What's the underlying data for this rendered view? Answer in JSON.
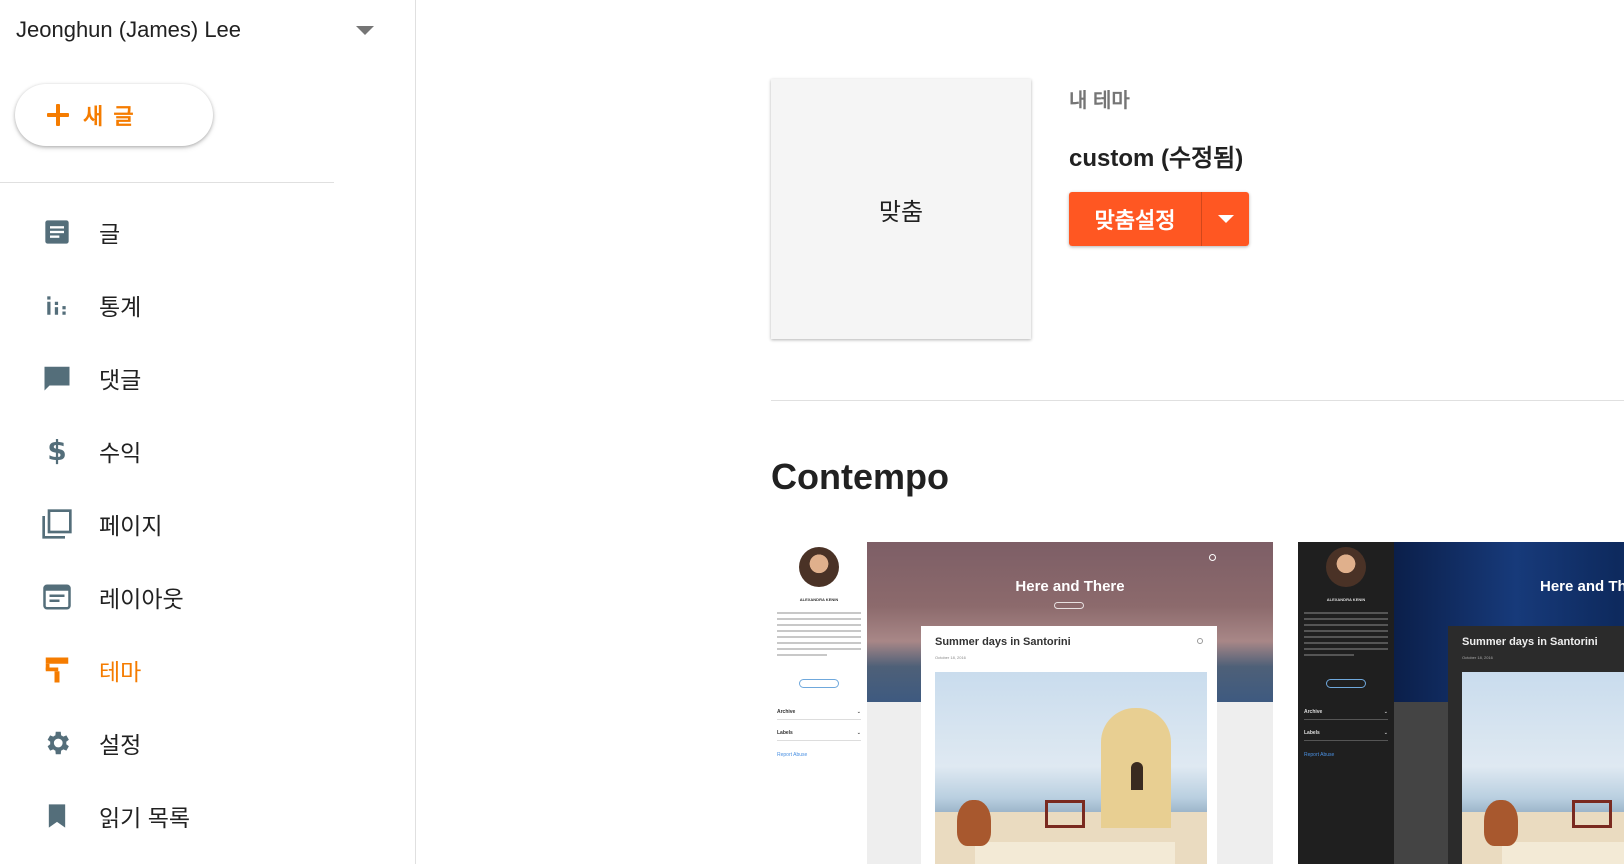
{
  "sidebar": {
    "account_name": "Jeonghun (James) Lee",
    "new_post_label": "새 글",
    "items": [
      {
        "label": "글",
        "icon": "posts-icon"
      },
      {
        "label": "통계",
        "icon": "stats-icon"
      },
      {
        "label": "댓글",
        "icon": "comments-icon"
      },
      {
        "label": "수익",
        "icon": "earnings-icon"
      },
      {
        "label": "페이지",
        "icon": "pages-icon"
      },
      {
        "label": "레이아웃",
        "icon": "layout-icon"
      },
      {
        "label": "테마",
        "icon": "theme-icon",
        "active": true
      },
      {
        "label": "설정",
        "icon": "settings-icon"
      },
      {
        "label": "읽기 목록",
        "icon": "reading-list-icon"
      }
    ]
  },
  "current_theme": {
    "thumbnail_label": "맞춤",
    "section_label": "내 테마",
    "name": "custom (수정됨)",
    "customize_label": "맞춤설정"
  },
  "theme_group": {
    "title": "Contempo",
    "previews": [
      {
        "variant": "light",
        "author": "ALEXANDRA KENIN",
        "blog_title": "Here and There",
        "post_title": "Summer days in Santorini",
        "post_date": "October 18, 2016",
        "archive_label": "Archive",
        "labels_label": "Labels",
        "report_label": "Report Abuse"
      },
      {
        "variant": "dark",
        "author": "ALEXANDRA KENIN",
        "blog_title": "Here and There",
        "post_title": "Summer days in Santorini",
        "post_date": "October 18, 2016",
        "archive_label": "Archive",
        "labels_label": "Labels",
        "report_label": "Report Abuse"
      }
    ]
  },
  "colors": {
    "accent": "#f57c00",
    "button": "#ff5722"
  }
}
